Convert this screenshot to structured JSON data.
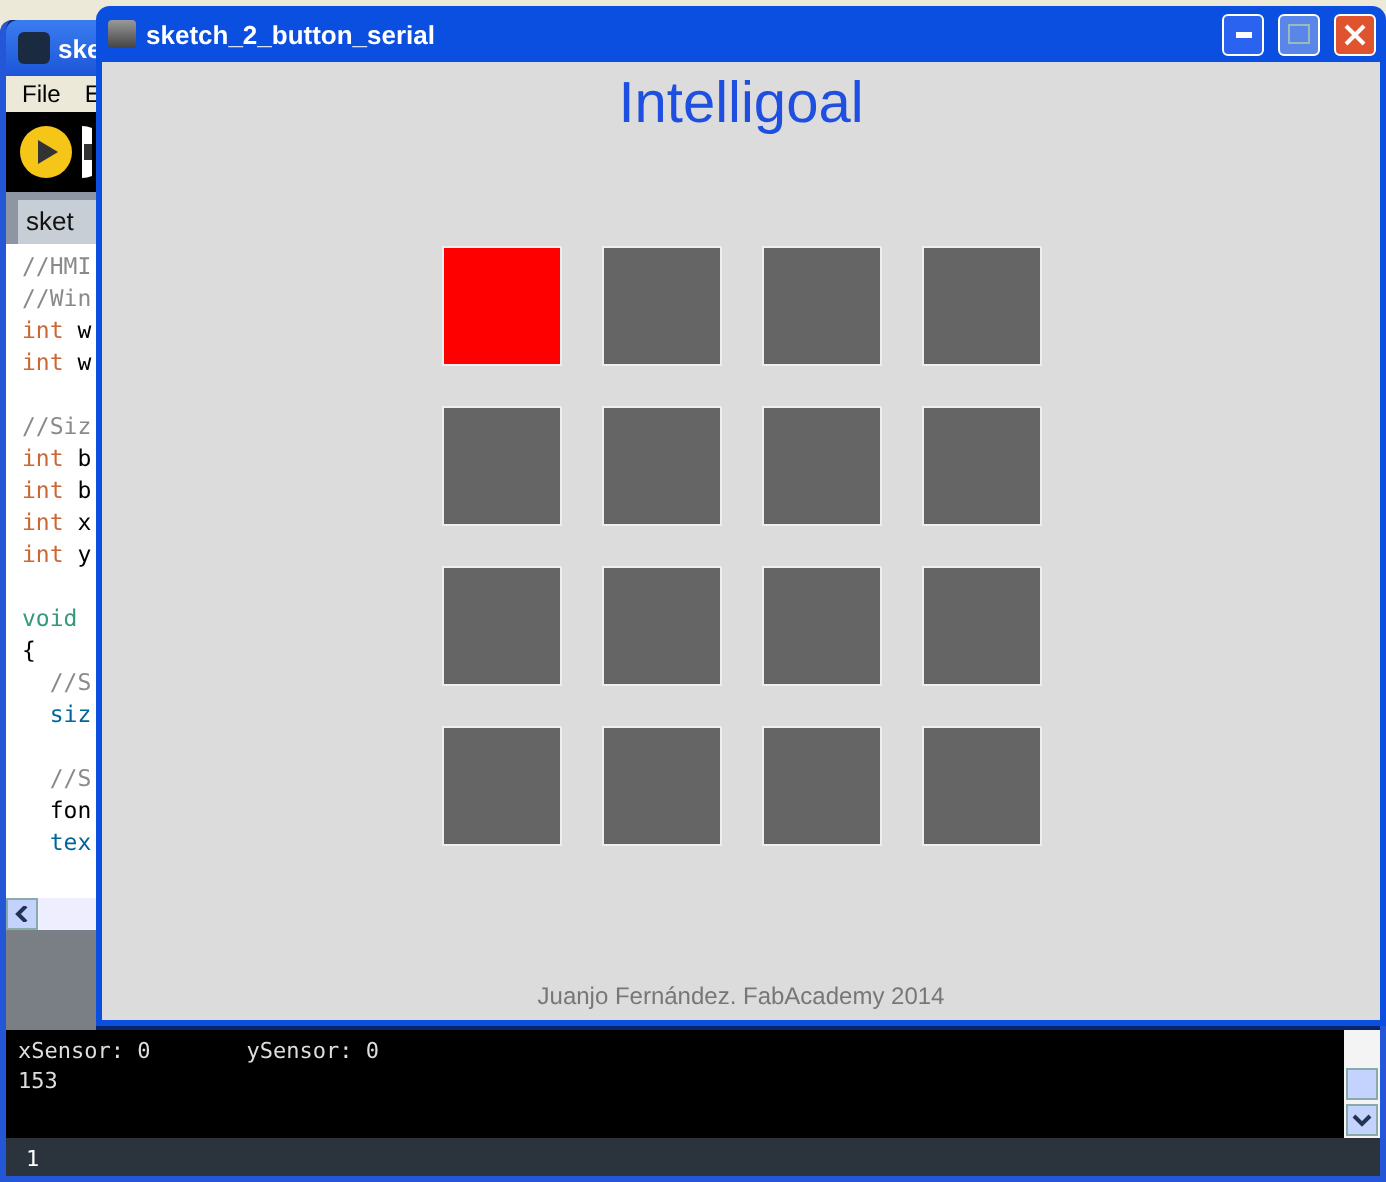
{
  "ide": {
    "title": "ske",
    "menu": [
      "File",
      "E"
    ],
    "tab": "sket",
    "code": [
      [
        {
          "text": "//HMI",
          "kind": "comment"
        }
      ],
      [
        {
          "text": "//Win",
          "kind": "comment"
        }
      ],
      [
        {
          "text": "int",
          "kind": "keyword"
        },
        {
          "text": " w",
          "kind": "plain"
        }
      ],
      [
        {
          "text": "int",
          "kind": "keyword"
        },
        {
          "text": " w",
          "kind": "plain"
        }
      ],
      {
        "space_before": true,
        "segments": [
          {
            "text": "//Siz",
            "kind": "comment"
          }
        ]
      },
      [
        {
          "text": "int",
          "kind": "keyword"
        },
        {
          "text": " b",
          "kind": "plain"
        }
      ],
      [
        {
          "text": "int",
          "kind": "keyword"
        },
        {
          "text": " b",
          "kind": "plain"
        }
      ],
      [
        {
          "text": "int",
          "kind": "keyword"
        },
        {
          "text": " x",
          "kind": "plain"
        }
      ],
      [
        {
          "text": "int",
          "kind": "keyword"
        },
        {
          "text": " y",
          "kind": "plain"
        }
      ],
      {
        "space_before": true,
        "segments": [
          {
            "text": "void",
            "kind": "type"
          }
        ]
      },
      [
        {
          "text": "{",
          "kind": "plain"
        }
      ],
      [
        {
          "text": "  //S",
          "kind": "comment"
        }
      ],
      [
        {
          "text": "  siz",
          "kind": "function"
        }
      ],
      {
        "space_before": true,
        "segments": [
          {
            "text": "  //S",
            "kind": "comment"
          }
        ]
      },
      [
        {
          "text": "  fon",
          "kind": "plain"
        }
      ],
      [
        {
          "text": "  tex",
          "kind": "function"
        }
      ]
    ],
    "console": [
      [
        "xSensor: 0",
        "ySensor: 0"
      ],
      [
        "153"
      ]
    ],
    "status": "1"
  },
  "sketch": {
    "title": "sketch_2_button_serial",
    "heading": "Intelligoal",
    "grid": [
      [
        {
          "selected": true
        },
        {
          "selected": false
        },
        {
          "selected": false
        },
        {
          "selected": false
        }
      ],
      [
        {
          "selected": false
        },
        {
          "selected": false
        },
        {
          "selected": false
        },
        {
          "selected": false
        }
      ],
      [
        {
          "selected": false
        },
        {
          "selected": false
        },
        {
          "selected": false
        },
        {
          "selected": false
        }
      ],
      [
        {
          "selected": false
        },
        {
          "selected": false
        },
        {
          "selected": false
        },
        {
          "selected": false
        }
      ]
    ],
    "footer": "Juanjo Fernández. FabAcademy 2014"
  }
}
